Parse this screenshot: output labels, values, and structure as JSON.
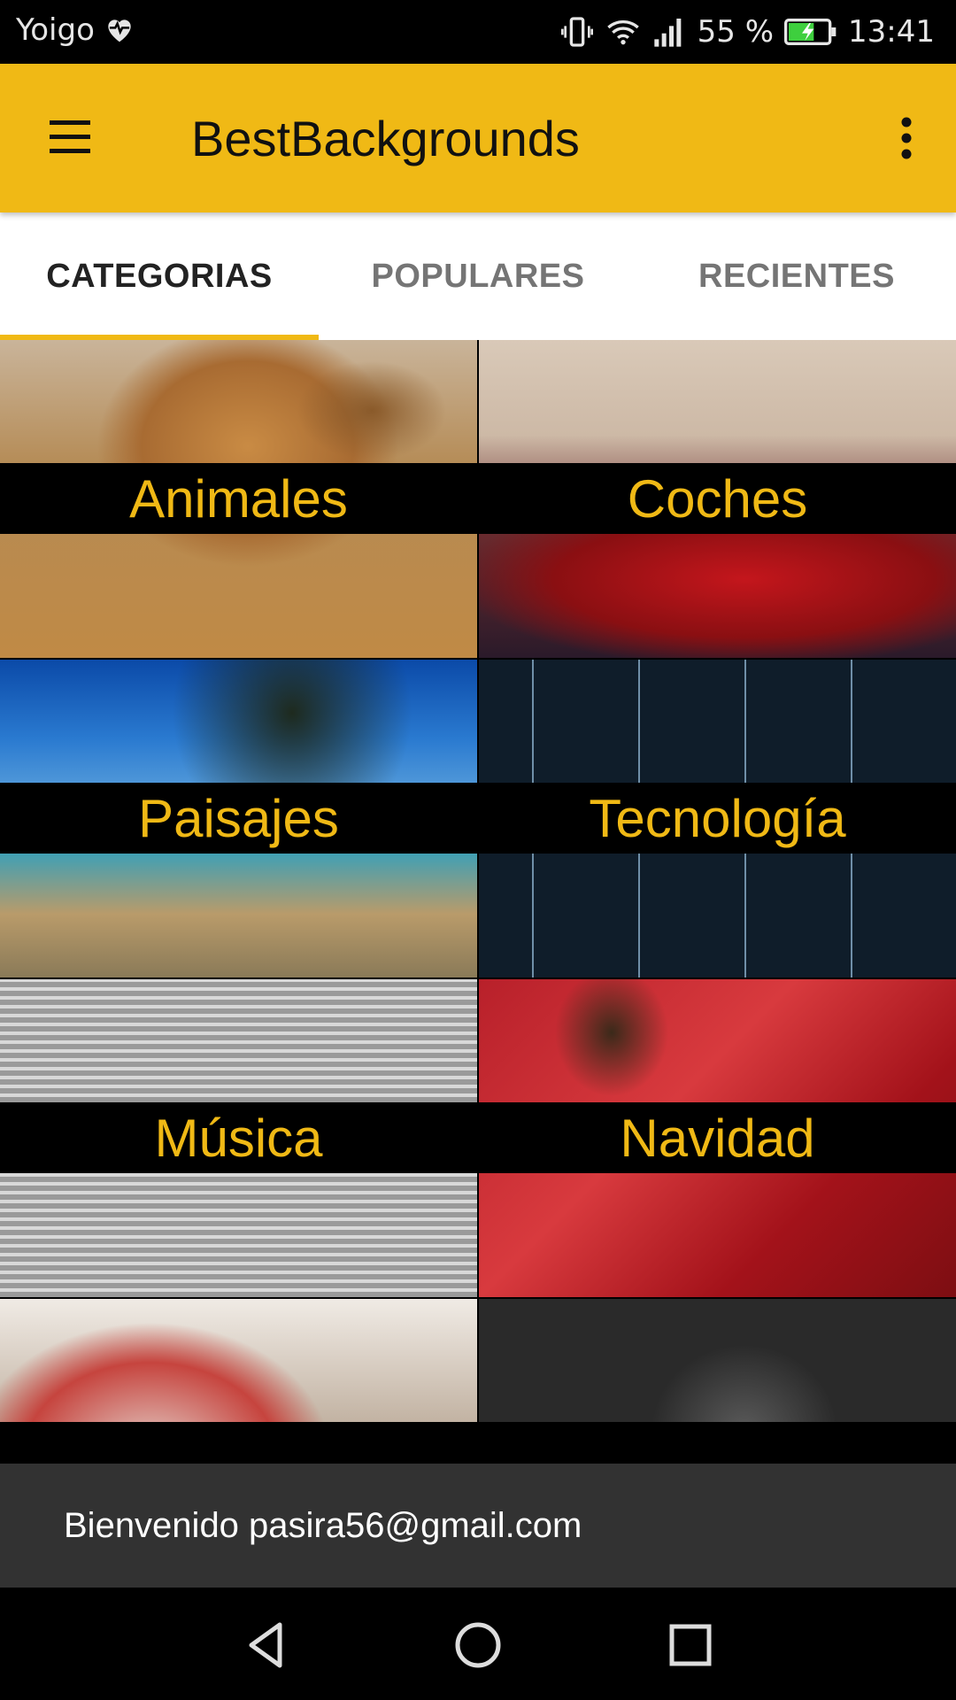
{
  "status_bar": {
    "carrier": "Yoigo",
    "battery_pct": "55 %",
    "time": "13:41",
    "icons": [
      "heart-monitor-icon",
      "vibrate-icon",
      "wifi-icon",
      "signal-icon",
      "battery-charging-icon"
    ]
  },
  "app_bar": {
    "title": "BestBackgrounds",
    "menu_icon": "hamburger-menu-icon",
    "more_icon": "more-vert-icon"
  },
  "tabs": [
    {
      "label": "CATEGORIAS",
      "active": true
    },
    {
      "label": "POPULARES",
      "active": false
    },
    {
      "label": "RECIENTES",
      "active": false
    }
  ],
  "categories": [
    {
      "label": "Animales"
    },
    {
      "label": "Coches"
    },
    {
      "label": "Paisajes"
    },
    {
      "label": "Tecnología"
    },
    {
      "label": "Música"
    },
    {
      "label": "Navidad"
    }
  ],
  "snackbar": {
    "message": "Bienvenido pasira56@gmail.com"
  },
  "colors": {
    "accent": "#f0b915",
    "tab_text_inactive": "#757575",
    "snackbar_bg": "#323232"
  }
}
